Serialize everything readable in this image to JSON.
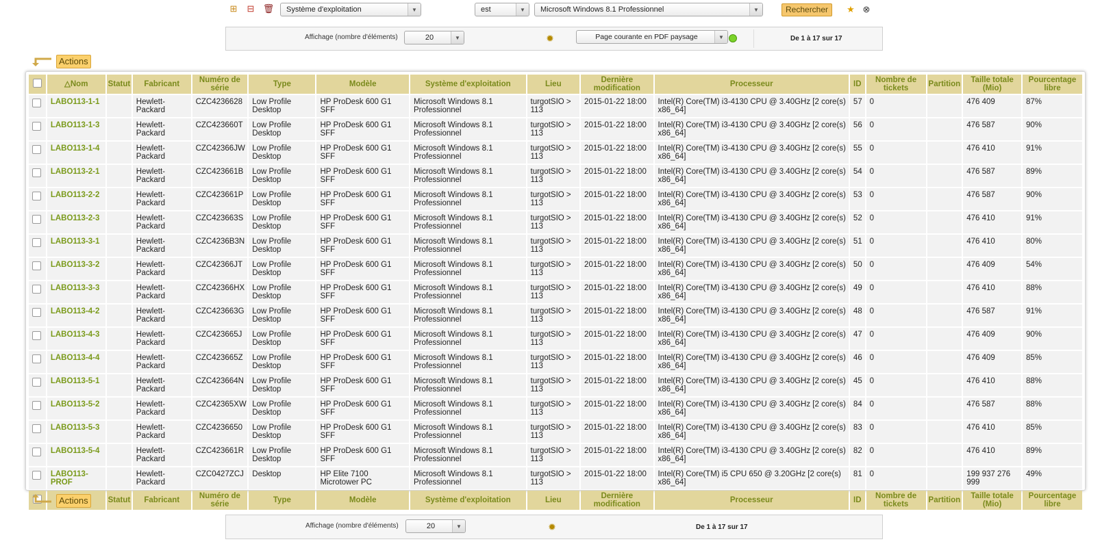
{
  "search": {
    "field": "Système d'exploitation",
    "operator": "est",
    "value": "Microsoft Windows 8.1 Professionnel",
    "button": "Rechercher"
  },
  "pager_top": {
    "display_label": "Affichage (nombre d'éléments)",
    "display_value": "20",
    "export": "Page courante en PDF paysage",
    "count": "De 1 à 17 sur 17"
  },
  "pager_bottom": {
    "display_label": "Affichage (nombre d'éléments)",
    "display_value": "20",
    "count": "De 1 à 17 sur 17"
  },
  "actions_label": "Actions",
  "columns": [
    "Nom",
    "Statut",
    "Fabricant",
    "Numéro de série",
    "Type",
    "Modèle",
    "Système d'exploitation",
    "Lieu",
    "Dernière modification",
    "Processeur",
    "ID",
    "Nombre de tickets",
    "Partition",
    "Taille totale (Mio)",
    "Pourcentage libre"
  ],
  "sort_indicator": "△",
  "rows": [
    {
      "nom": "LABO113-1-1",
      "statut": "",
      "fabricant": "Hewlett-Packard",
      "serie": "CZC4236628",
      "type": "Low Profile Desktop",
      "modele": "HP ProDesk 600 G1 SFF",
      "os": "Microsoft Windows 8.1 Professionnel",
      "lieu": "turgotSIO > 113",
      "modif": "2015-01-22 18:00",
      "cpu": "Intel(R) Core(TM) i3-4130 CPU @ 3.40GHz [2 core(s) x86_64]",
      "id": "57",
      "tickets": "0",
      "partition": "",
      "taille": "476 409",
      "libre": "87%"
    },
    {
      "nom": "LABO113-1-3",
      "statut": "",
      "fabricant": "Hewlett-Packard",
      "serie": "CZC423660T",
      "type": "Low Profile Desktop",
      "modele": "HP ProDesk 600 G1 SFF",
      "os": "Microsoft Windows 8.1 Professionnel",
      "lieu": "turgotSIO > 113",
      "modif": "2015-01-22 18:00",
      "cpu": "Intel(R) Core(TM) i3-4130 CPU @ 3.40GHz [2 core(s) x86_64]",
      "id": "56",
      "tickets": "0",
      "partition": "",
      "taille": "476 587",
      "libre": "90%"
    },
    {
      "nom": "LABO113-1-4",
      "statut": "",
      "fabricant": "Hewlett-Packard",
      "serie": "CZC42366JW",
      "type": "Low Profile Desktop",
      "modele": "HP ProDesk 600 G1 SFF",
      "os": "Microsoft Windows 8.1 Professionnel",
      "lieu": "turgotSIO > 113",
      "modif": "2015-01-22 18:00",
      "cpu": "Intel(R) Core(TM) i3-4130 CPU @ 3.40GHz [2 core(s) x86_64]",
      "id": "55",
      "tickets": "0",
      "partition": "",
      "taille": "476 410",
      "libre": "91%"
    },
    {
      "nom": "LABO113-2-1",
      "statut": "",
      "fabricant": "Hewlett-Packard",
      "serie": "CZC423661B",
      "type": "Low Profile Desktop",
      "modele": "HP ProDesk 600 G1 SFF",
      "os": "Microsoft Windows 8.1 Professionnel",
      "lieu": "turgotSIO > 113",
      "modif": "2015-01-22 18:00",
      "cpu": "Intel(R) Core(TM) i3-4130 CPU @ 3.40GHz [2 core(s) x86_64]",
      "id": "54",
      "tickets": "0",
      "partition": "",
      "taille": "476 587",
      "libre": "89%"
    },
    {
      "nom": "LABO113-2-2",
      "statut": "",
      "fabricant": "Hewlett-Packard",
      "serie": "CZC423661P",
      "type": "Low Profile Desktop",
      "modele": "HP ProDesk 600 G1 SFF",
      "os": "Microsoft Windows 8.1 Professionnel",
      "lieu": "turgotSIO > 113",
      "modif": "2015-01-22 18:00",
      "cpu": "Intel(R) Core(TM) i3-4130 CPU @ 3.40GHz [2 core(s) x86_64]",
      "id": "53",
      "tickets": "0",
      "partition": "",
      "taille": "476 587",
      "libre": "90%"
    },
    {
      "nom": "LABO113-2-3",
      "statut": "",
      "fabricant": "Hewlett-Packard",
      "serie": "CZC423663S",
      "type": "Low Profile Desktop",
      "modele": "HP ProDesk 600 G1 SFF",
      "os": "Microsoft Windows 8.1 Professionnel",
      "lieu": "turgotSIO > 113",
      "modif": "2015-01-22 18:00",
      "cpu": "Intel(R) Core(TM) i3-4130 CPU @ 3.40GHz [2 core(s) x86_64]",
      "id": "52",
      "tickets": "0",
      "partition": "",
      "taille": "476 410",
      "libre": "91%"
    },
    {
      "nom": "LABO113-3-1",
      "statut": "",
      "fabricant": "Hewlett-Packard",
      "serie": "CZC4236B3N",
      "type": "Low Profile Desktop",
      "modele": "HP ProDesk 600 G1 SFF",
      "os": "Microsoft Windows 8.1 Professionnel",
      "lieu": "turgotSIO > 113",
      "modif": "2015-01-22 18:00",
      "cpu": "Intel(R) Core(TM) i3-4130 CPU @ 3.40GHz [2 core(s) x86_64]",
      "id": "51",
      "tickets": "0",
      "partition": "",
      "taille": "476 410",
      "libre": "80%"
    },
    {
      "nom": "LABO113-3-2",
      "statut": "",
      "fabricant": "Hewlett-Packard",
      "serie": "CZC42366JT",
      "type": "Low Profile Desktop",
      "modele": "HP ProDesk 600 G1 SFF",
      "os": "Microsoft Windows 8.1 Professionnel",
      "lieu": "turgotSIO > 113",
      "modif": "2015-01-22 18:00",
      "cpu": "Intel(R) Core(TM) i3-4130 CPU @ 3.40GHz [2 core(s) x86_64]",
      "id": "50",
      "tickets": "0",
      "partition": "",
      "taille": "476 409",
      "libre": "54%"
    },
    {
      "nom": "LABO113-3-3",
      "statut": "",
      "fabricant": "Hewlett-Packard",
      "serie": "CZC42366HX",
      "type": "Low Profile Desktop",
      "modele": "HP ProDesk 600 G1 SFF",
      "os": "Microsoft Windows 8.1 Professionnel",
      "lieu": "turgotSIO > 113",
      "modif": "2015-01-22 18:00",
      "cpu": "Intel(R) Core(TM) i3-4130 CPU @ 3.40GHz [2 core(s) x86_64]",
      "id": "49",
      "tickets": "0",
      "partition": "",
      "taille": "476 410",
      "libre": "88%"
    },
    {
      "nom": "LABO113-4-2",
      "statut": "",
      "fabricant": "Hewlett-Packard",
      "serie": "CZC423663G",
      "type": "Low Profile Desktop",
      "modele": "HP ProDesk 600 G1 SFF",
      "os": "Microsoft Windows 8.1 Professionnel",
      "lieu": "turgotSIO > 113",
      "modif": "2015-01-22 18:00",
      "cpu": "Intel(R) Core(TM) i3-4130 CPU @ 3.40GHz [2 core(s) x86_64]",
      "id": "48",
      "tickets": "0",
      "partition": "",
      "taille": "476 587",
      "libre": "91%"
    },
    {
      "nom": "LABO113-4-3",
      "statut": "",
      "fabricant": "Hewlett-Packard",
      "serie": "CZC423665J",
      "type": "Low Profile Desktop",
      "modele": "HP ProDesk 600 G1 SFF",
      "os": "Microsoft Windows 8.1 Professionnel",
      "lieu": "turgotSIO > 113",
      "modif": "2015-01-22 18:00",
      "cpu": "Intel(R) Core(TM) i3-4130 CPU @ 3.40GHz [2 core(s) x86_64]",
      "id": "47",
      "tickets": "0",
      "partition": "",
      "taille": "476 409",
      "libre": "90%"
    },
    {
      "nom": "LABO113-4-4",
      "statut": "",
      "fabricant": "Hewlett-Packard",
      "serie": "CZC423665Z",
      "type": "Low Profile Desktop",
      "modele": "HP ProDesk 600 G1 SFF",
      "os": "Microsoft Windows 8.1 Professionnel",
      "lieu": "turgotSIO > 113",
      "modif": "2015-01-22 18:00",
      "cpu": "Intel(R) Core(TM) i3-4130 CPU @ 3.40GHz [2 core(s) x86_64]",
      "id": "46",
      "tickets": "0",
      "partition": "",
      "taille": "476 409",
      "libre": "85%"
    },
    {
      "nom": "LABO113-5-1",
      "statut": "",
      "fabricant": "Hewlett-Packard",
      "serie": "CZC423664N",
      "type": "Low Profile Desktop",
      "modele": "HP ProDesk 600 G1 SFF",
      "os": "Microsoft Windows 8.1 Professionnel",
      "lieu": "turgotSIO > 113",
      "modif": "2015-01-22 18:00",
      "cpu": "Intel(R) Core(TM) i3-4130 CPU @ 3.40GHz [2 core(s) x86_64]",
      "id": "45",
      "tickets": "0",
      "partition": "",
      "taille": "476 410",
      "libre": "88%"
    },
    {
      "nom": "LABO113-5-2",
      "statut": "",
      "fabricant": "Hewlett-Packard",
      "serie": "CZC42365XW",
      "type": "Low Profile Desktop",
      "modele": "HP ProDesk 600 G1 SFF",
      "os": "Microsoft Windows 8.1 Professionnel",
      "lieu": "turgotSIO > 113",
      "modif": "2015-01-22 18:00",
      "cpu": "Intel(R) Core(TM) i3-4130 CPU @ 3.40GHz [2 core(s) x86_64]",
      "id": "84",
      "tickets": "0",
      "partition": "",
      "taille": "476 587",
      "libre": "88%"
    },
    {
      "nom": "LABO113-5-3",
      "statut": "",
      "fabricant": "Hewlett-Packard",
      "serie": "CZC4236650",
      "type": "Low Profile Desktop",
      "modele": "HP ProDesk 600 G1 SFF",
      "os": "Microsoft Windows 8.1 Professionnel",
      "lieu": "turgotSIO > 113",
      "modif": "2015-01-22 18:00",
      "cpu": "Intel(R) Core(TM) i3-4130 CPU @ 3.40GHz [2 core(s) x86_64]",
      "id": "83",
      "tickets": "0",
      "partition": "",
      "taille": "476 410",
      "libre": "85%"
    },
    {
      "nom": "LABO113-5-4",
      "statut": "",
      "fabricant": "Hewlett-Packard",
      "serie": "CZC423661R",
      "type": "Low Profile Desktop",
      "modele": "HP ProDesk 600 G1 SFF",
      "os": "Microsoft Windows 8.1 Professionnel",
      "lieu": "turgotSIO > 113",
      "modif": "2015-01-22 18:00",
      "cpu": "Intel(R) Core(TM) i3-4130 CPU @ 3.40GHz [2 core(s) x86_64]",
      "id": "82",
      "tickets": "0",
      "partition": "",
      "taille": "476 410",
      "libre": "89%"
    },
    {
      "nom": "LABO113-PROF",
      "statut": "",
      "fabricant": "Hewlett-Packard",
      "serie": "CZC0427ZCJ",
      "type": "Desktop",
      "modele": "HP Elite 7100 Microtower PC",
      "os": "Microsoft Windows 8.1 Professionnel",
      "lieu": "turgotSIO > 113",
      "modif": "2015-01-22 18:00",
      "cpu": "Intel(R) Core(TM) i5 CPU 650 @ 3.20GHz [2 core(s) x86_64]",
      "id": "81",
      "tickets": "0",
      "partition": "",
      "taille": "199 937 276 999",
      "libre": "49%"
    }
  ]
}
